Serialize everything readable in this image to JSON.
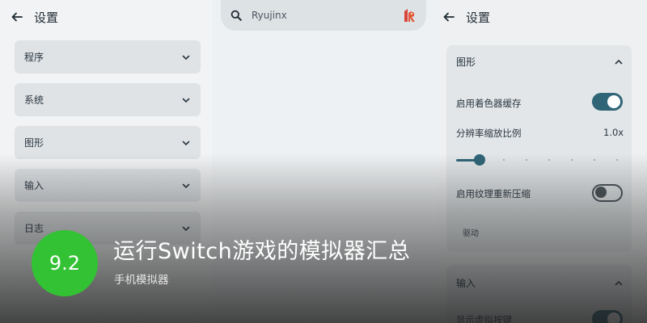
{
  "left": {
    "title": "设置",
    "sections": [
      "程序",
      "系统",
      "图形",
      "输入",
      "日志"
    ]
  },
  "search": {
    "text": "Ryujinx"
  },
  "right": {
    "title": "设置",
    "panel_title": "图形",
    "shader_cache_label": "启用着色器缓存",
    "shader_cache_on": true,
    "resolution_label": "分辨率缩放比例",
    "resolution_value": "1.0x",
    "texture_recompress_label": "启用纹理重新压缩",
    "texture_recompress_on": false,
    "driver_label": "驱动",
    "panel2_title": "输入",
    "panel2_row_label": "显示虚拟按键"
  },
  "overlay": {
    "score": "9.2",
    "headline": "运行Switch游戏的模拟器汇总",
    "subline": "手机模拟器"
  },
  "colors": {
    "accent": "#2f6577",
    "score_bg": "#33c233",
    "card": "#dfe3e6"
  }
}
